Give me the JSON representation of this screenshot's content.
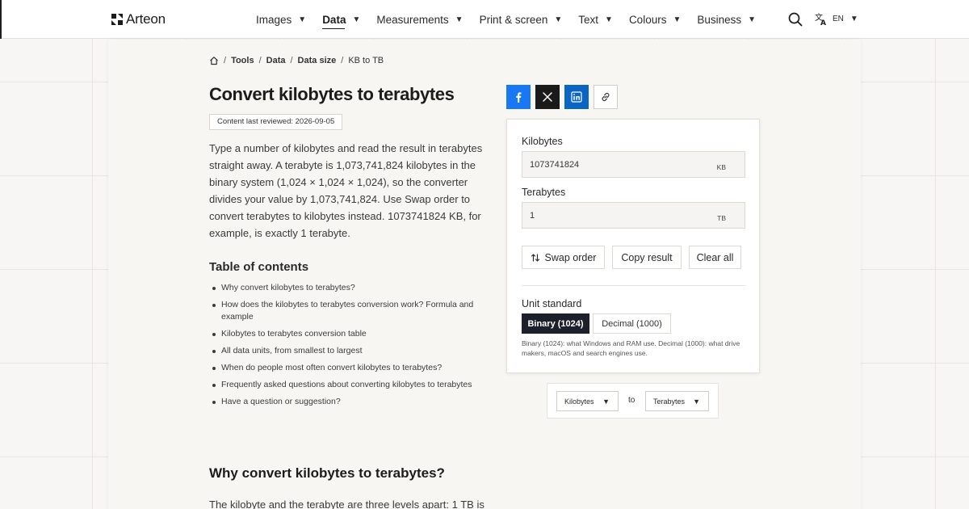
{
  "brand": {
    "name": "Arteon",
    "logo_icon": "arteon-logo-icon"
  },
  "nav": {
    "items": [
      {
        "label": "Images",
        "active": false
      },
      {
        "label": "Data",
        "active": true
      },
      {
        "label": "Measurements",
        "active": false
      },
      {
        "label": "Print & screen",
        "active": false
      },
      {
        "label": "Text",
        "active": false
      },
      {
        "label": "Colours",
        "active": false
      },
      {
        "label": "Business",
        "active": false
      }
    ],
    "search_icon": "search-icon",
    "language": {
      "icon": "translate-icon",
      "code": "EN"
    }
  },
  "breadcrumb": {
    "home_icon": "home-icon",
    "items": [
      "Tools",
      "Data",
      "Data size"
    ],
    "current": "KB to TB"
  },
  "page": {
    "title": "Convert kilobytes to terabytes",
    "reviewed": "Content last reviewed: 2026-09-05",
    "intro": "Type a number of kilobytes and read the result in terabytes straight away. A terabyte is 1,073,741,824 kilobytes in the binary system (1,024 × 1,024 × 1,024), so the converter divides your value by 1,073,741,824. Use Swap order to convert terabytes to kilobytes instead. 1073741824 KB, for example, is exactly 1 terabyte.",
    "toc_title": "Table of contents",
    "toc": [
      "Why convert kilobytes to terabytes?",
      "How does the kilobytes to terabytes conversion work? Formula and example",
      "Kilobytes to terabytes conversion table",
      "All data units, from smallest to largest",
      "When do people most often convert kilobytes to terabytes?",
      "Frequently asked questions about converting kilobytes to terabytes",
      "Have a question or suggestion?"
    ],
    "section_title": "Why convert kilobytes to terabytes?",
    "section_text_start": "The kilobyte and the terabyte are three levels apart: 1 TB is"
  },
  "share": {
    "buttons": [
      {
        "name": "facebook",
        "icon": "facebook-icon",
        "color": "#1877f2"
      },
      {
        "name": "x",
        "icon": "x-icon",
        "color": "#1a1a1a"
      },
      {
        "name": "linkedin",
        "icon": "linkedin-icon",
        "color": "#0a66c2"
      },
      {
        "name": "copy-link",
        "icon": "link-icon",
        "color": "#ffffff"
      }
    ]
  },
  "converter": {
    "from_label": "Kilobytes",
    "from_value": "1073741824",
    "from_unit": "KB",
    "to_label": "Terabytes",
    "to_value": "1",
    "to_unit": "TB",
    "swap_label": "Swap order",
    "copy_label": "Copy result",
    "clear_label": "Clear all",
    "standard_label": "Unit standard",
    "standard_binary": "Binary (1024)",
    "standard_decimal": "Decimal (1000)",
    "standard_selected": "Binary (1024)",
    "standard_note": "Binary (1024): what Windows and RAM use. Decimal (1000): what drive makers, macOS and search engines use."
  },
  "unit_select": {
    "from": "Kilobytes",
    "to_word": "to",
    "to": "Terabytes"
  },
  "colors": {
    "accent_dark": "#1d1f2a",
    "facebook": "#1877f2",
    "linkedin": "#0a66c2",
    "background": "#f7f6f4"
  }
}
